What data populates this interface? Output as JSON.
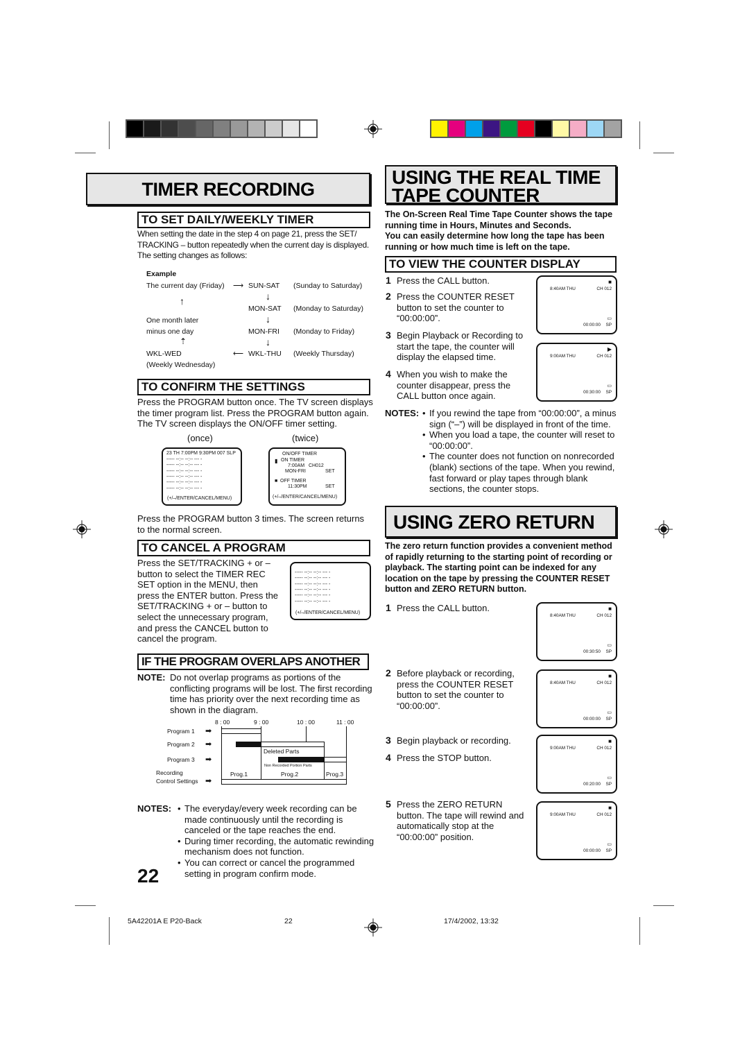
{
  "print_marks": {
    "grayscale_swatches": [
      "#000000",
      "#1a1a1a",
      "#333333",
      "#4d4d4d",
      "#666666",
      "#808080",
      "#999999",
      "#b3b3b3",
      "#cccccc",
      "#e6e6e6",
      "#ffffff"
    ],
    "color_swatches": [
      "#fff200",
      "#e5007e",
      "#00a0e9",
      "#3c1583",
      "#009b3e",
      "#e60020",
      "#000000",
      "#fff9a6",
      "#f5adc6",
      "#9dd7f5",
      "#a3a3a3"
    ]
  },
  "left": {
    "title": "TIMER RECORDING",
    "daily_weekly": {
      "heading": "TO SET DAILY/WEEKLY TIMER",
      "intro": "When setting the date in the step 4 on page 21, press the SET/ TRACKING – button repeatedly when the current day is displayed. The setting changes as follows:",
      "example_label": "Example",
      "current_day": "The current day (Friday)",
      "one_month_later": "One month later",
      "minus_one_day": "minus one day",
      "wkl_wed": "WKL-WED",
      "wkl_wed_desc": "(Weekly Wednesday)",
      "cycle": [
        {
          "code": "SUN-SAT",
          "desc": "(Sunday to Saturday)"
        },
        {
          "code": "MON-SAT",
          "desc": "(Monday to Saturday)"
        },
        {
          "code": "MON-FRI",
          "desc": "(Monday to Friday)"
        },
        {
          "code": "WKL-THU",
          "desc": "(Weekly Thursday)"
        }
      ]
    },
    "confirm": {
      "heading": "TO CONFIRM THE SETTINGS",
      "text": "Press the PROGRAM button once. The TV screen displays the timer program list. Press the PROGRAM button again. The TV screen displays the ON/OFF timer setting.",
      "once_label": "(once)",
      "twice_label": "(twice)",
      "screen_once": {
        "header": "23 TH    7:00PM   9:30PM  007  SLP",
        "rows": [
          "-----  --:--   --:--   ---  -",
          "-----  --:--   --:--   ---  -",
          "-----  --:--   --:--   ---  -",
          "-----  --:--   --:--   ---  -",
          "-----  --:--   --:--   ---  -",
          "-----  --:--   --:--   ---  -"
        ],
        "footer": "(+/–/ENTER/CANCEL/MENU)"
      },
      "screen_twice": {
        "title": "ON/OFF  TIMER",
        "on_timer": "ON  TIMER",
        "on_time": "7:00AM",
        "on_channel": "CH012",
        "on_days": "MON-FRI",
        "on_set": "SET",
        "off_timer": "OFF  TIMER",
        "off_time": "11:30PM",
        "off_set": "SET",
        "footer": "(+/–/ENTER/CANCEL/MENU)"
      },
      "after_text": "Press the PROGRAM button 3 times. The screen returns to the normal screen."
    },
    "cancel": {
      "heading": "TO CANCEL A PROGRAM",
      "text": "Press the SET/TRACKING + or – button to select the TIMER REC SET option in the MENU, then press the ENTER button. Press the SET/TRACKING + or – button to select the unnecessary program, and press the CANCEL button to cancel the program.",
      "screen": {
        "rows": [
          "-----  --:--   --:--   ---  -",
          "-----  --:--   --:--   ---  -",
          "-----  --:--   --:--   ---  -",
          "-----  --:--   --:--   ---  -",
          "-----  --:--   --:--   ---  -",
          "-----  --:--   --:--   ---  -"
        ],
        "footer": "(+/–/ENTER/CANCEL/MENU)"
      }
    },
    "overlap": {
      "heading": "IF THE PROGRAM OVERLAPS ANOTHER",
      "note_label": "NOTE:",
      "note_text": "Do not overlap programs as portions of the conflicting programs will be lost. The first recording time has priority over the next recording time as shown in the diagram.",
      "diagram": {
        "times": [
          "8 : 00",
          "9 : 00",
          "10 : 00",
          "11 : 00"
        ],
        "program1": "Program 1",
        "program2": "Program 2",
        "program3": "Program 3",
        "recording": "Recording",
        "control_settings": "Control Settings",
        "deleted_parts": "Deleted Parts",
        "non_recorded": "Non Recorded Portion Parts",
        "prog1": "Prog.1",
        "prog2": "Prog.2",
        "prog3": "Prog.3"
      }
    },
    "notes": {
      "label": "NOTES:",
      "items": [
        "The everyday/every week recording can be made continuously until the recording is canceled or the tape reaches the end.",
        "During timer recording, the automatic rewinding mechanism does not function.",
        "You can correct or cancel the programmed setting in program confirm mode."
      ]
    },
    "page_number": "22"
  },
  "right": {
    "counter_title_1": "USING THE REAL TIME",
    "counter_title_2": "TAPE COUNTER",
    "counter_intro_1": "The On-Screen Real Time Tape Counter shows the tape running time in Hours, Minutes and Seconds.",
    "counter_intro_2": "You can easily determine how long the tape has been running or how much time is left on the tape.",
    "view_heading": "TO VIEW THE COUNTER DISPLAY",
    "view_steps": [
      {
        "num": "1",
        "text": "Press the CALL button."
      },
      {
        "num": "2",
        "text": "Press the COUNTER RESET button to set the counter to “00:00:00”."
      },
      {
        "num": "3",
        "text": "Begin Playback or Recording to start the tape, the counter will display the elapsed time."
      },
      {
        "num": "4",
        "text": "When you wish to make the counter disappear, press the CALL button once again."
      }
    ],
    "view_screens": [
      {
        "time": "8:40AM  THU",
        "channel": "CH 012",
        "counter": "00:00:00",
        "mode": "SP",
        "state": "stop"
      },
      {
        "time": "9:00AM  THU",
        "channel": "CH 012",
        "counter": "00:30:00",
        "mode": "SP",
        "state": "play"
      }
    ],
    "view_notes": {
      "label": "NOTES:",
      "items": [
        "If you rewind the tape from “00:00:00”, a minus sign (“–”) will be displayed in front of the time.",
        "When you load a tape, the counter will reset to “00:00:00”.",
        "The counter does not function on nonrecorded (blank) sections of the tape. When you rewind, fast forward or play tapes through blank sections, the counter stops."
      ]
    },
    "zero_title": "USING ZERO RETURN",
    "zero_intro": "The zero return function provides a convenient method of rapidly returning to the starting point of recording or playback. The starting point can be indexed for any location on the tape by pressing the COUNTER RESET button and ZERO RETURN button.",
    "zero_steps": [
      {
        "num": "1",
        "text": "Press the CALL button."
      },
      {
        "num": "2",
        "text": "Before playback or recording, press the COUNTER RESET button to set the counter to “00:00:00”."
      },
      {
        "num": "3",
        "text": "Begin playback or recording."
      },
      {
        "num": "4",
        "text": "Press the STOP button."
      },
      {
        "num": "5",
        "text": "Press the ZERO RETURN button. The tape will rewind and automatically stop at the “00:00:00” position."
      }
    ],
    "zero_screens": [
      {
        "time": "8:40AM  THU",
        "channel": "CH 012",
        "counter": "00:30:50",
        "mode": "SP",
        "state": "stop"
      },
      {
        "time": "8:40AM  THU",
        "channel": "CH 012",
        "counter": "00:00:00",
        "mode": "SP",
        "state": "stop"
      },
      {
        "time": "9:00AM  THU",
        "channel": "CH 012",
        "counter": "00:20:00",
        "mode": "SP",
        "state": "stop"
      },
      {
        "time": "9:00AM  THU",
        "channel": "CH 012",
        "counter": "00:00:00",
        "mode": "SP",
        "state": "stop"
      }
    ]
  },
  "footer": {
    "doc_id": "5A42201A E P20-Back",
    "page": "22",
    "timestamp": "17/4/2002, 13:32"
  }
}
